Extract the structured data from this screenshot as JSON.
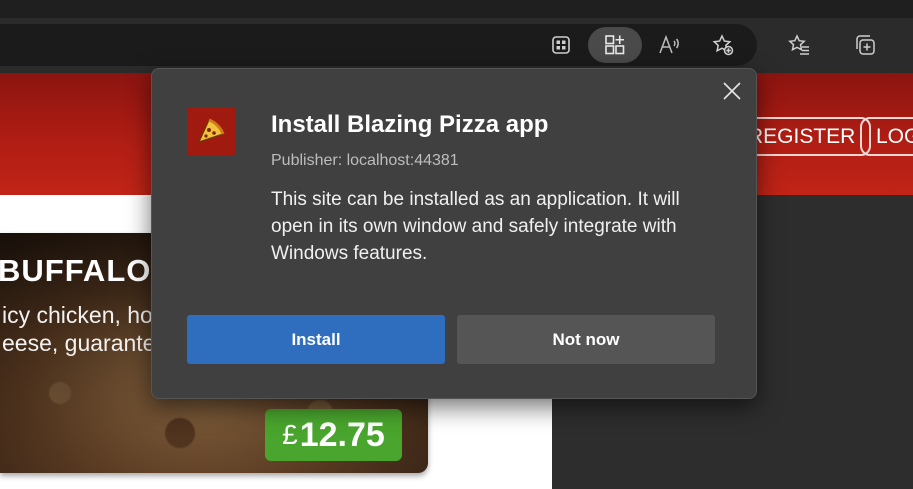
{
  "browser": {
    "toolbar_icons": [
      "app-tiles-icon",
      "install-app-icon",
      "read-aloud-icon",
      "add-favorite-icon",
      "favorites-icon",
      "collections-icon"
    ]
  },
  "site": {
    "nav": {
      "register_label": "REGISTER",
      "login_label": "LOG"
    },
    "pizza": {
      "title": "BUFFALO CH",
      "desc_line1": "icy chicken, ho",
      "desc_line2": "eese, guarante",
      "price_currency": "£",
      "price_value": "12.75"
    },
    "colors": {
      "header_red": "#b21e14",
      "price_green": "#49a52d"
    }
  },
  "dialog": {
    "title": "Install Blazing Pizza app",
    "publisher": "Publisher: localhost:44381",
    "description": "This site can be installed as an application. It will open in its own window and safely integrate with Windows features.",
    "install_label": "Install",
    "not_now_label": "Not now",
    "app_icon": "pizza-slice-icon",
    "colors": {
      "install_blue": "#2f6ebf",
      "background": "#404040"
    }
  }
}
